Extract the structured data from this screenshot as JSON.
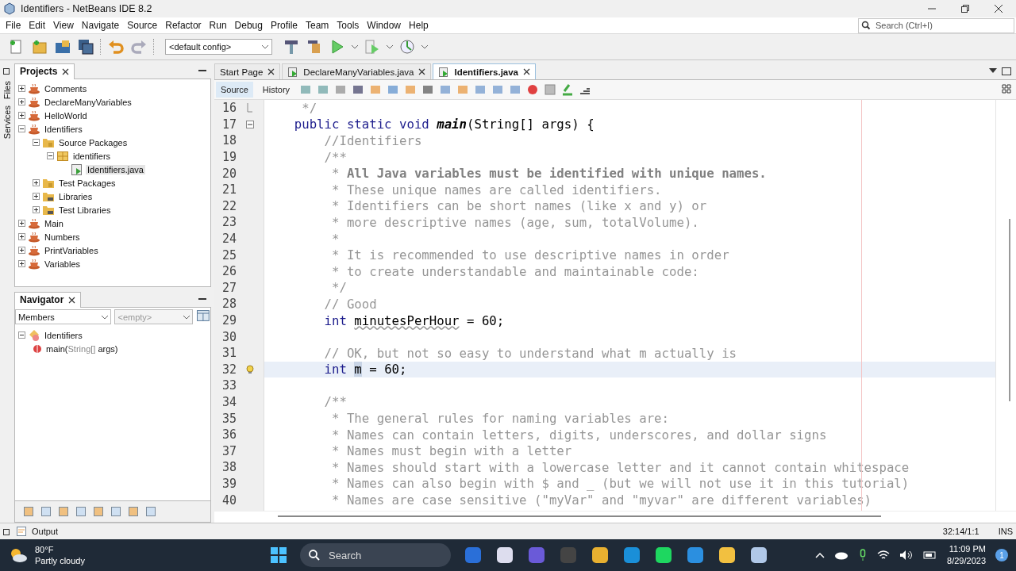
{
  "window": {
    "title": "Identifiers - NetBeans IDE 8.2"
  },
  "menu": [
    "File",
    "Edit",
    "View",
    "Navigate",
    "Source",
    "Refactor",
    "Run",
    "Debug",
    "Profile",
    "Team",
    "Tools",
    "Window",
    "Help"
  ],
  "search": {
    "placeholder": "Search (Ctrl+I)"
  },
  "toolbar": {
    "config": "<default config>"
  },
  "side_tabs": [
    "Files",
    "Services"
  ],
  "projects": {
    "title": "Projects",
    "items": [
      {
        "label": "Comments",
        "kind": "project",
        "expanded": false,
        "selected": false
      },
      {
        "label": "DeclareManyVariables",
        "kind": "project",
        "expanded": false,
        "selected": false
      },
      {
        "label": "HelloWorld",
        "kind": "project",
        "expanded": false,
        "selected": false
      },
      {
        "label": "Identifiers",
        "kind": "project",
        "expanded": true,
        "selected": false,
        "children": [
          {
            "label": "Source Packages",
            "kind": "folder",
            "expanded": true,
            "selected": false,
            "children": [
              {
                "label": "identifiers",
                "kind": "package",
                "expanded": true,
                "selected": false,
                "children": [
                  {
                    "label": "Identifiers.java",
                    "kind": "file",
                    "selected": true
                  }
                ]
              }
            ]
          },
          {
            "label": "Test Packages",
            "kind": "folder",
            "expanded": false,
            "selected": false
          },
          {
            "label": "Libraries",
            "kind": "library",
            "expanded": false,
            "selected": false
          },
          {
            "label": "Test Libraries",
            "kind": "library",
            "expanded": false,
            "selected": false
          }
        ]
      },
      {
        "label": "Main",
        "kind": "project",
        "expanded": false,
        "selected": false
      },
      {
        "label": "Numbers",
        "kind": "project",
        "expanded": false,
        "selected": false
      },
      {
        "label": "PrintVariables",
        "kind": "project",
        "expanded": false,
        "selected": false
      },
      {
        "label": "Variables",
        "kind": "project",
        "expanded": false,
        "selected": false
      }
    ]
  },
  "navigator": {
    "title": "Navigator",
    "filter": "Members",
    "secondary": {
      "placeholder": "<empty>",
      "disabled": true
    },
    "class_name": "Identifiers",
    "member": {
      "name": "main(",
      "param_type": "String[]",
      "param_rest": " args)"
    }
  },
  "editor_tabs": [
    {
      "label": "Start Page",
      "selected": false
    },
    {
      "label": "DeclareManyVariables.java",
      "selected": false
    },
    {
      "label": "Identifiers.java",
      "selected": true
    }
  ],
  "view_tabs": [
    {
      "label": "Source",
      "selected": true
    },
    {
      "label": "History",
      "selected": false
    }
  ],
  "code": [
    {
      "number": "16",
      "current": false,
      "hint": false,
      "fold_end": true,
      "fold_start": false,
      "tokens": [
        {
          "kind": "doc",
          "text": "     */"
        }
      ]
    },
    {
      "number": "17",
      "current": false,
      "hint": false,
      "fold_end": false,
      "fold_start": true,
      "tokens": [
        {
          "kind": "keyword",
          "text": "    public static void "
        },
        {
          "kind": "method",
          "text": "main"
        },
        {
          "kind": "plain",
          "text": "(String[] args) {"
        }
      ]
    },
    {
      "number": "18",
      "current": false,
      "hint": false,
      "tokens": [
        {
          "kind": "comment",
          "text": "        //Identifiers"
        }
      ]
    },
    {
      "number": "19",
      "current": false,
      "hint": false,
      "tokens": [
        {
          "kind": "doc",
          "text": "        /**"
        }
      ]
    },
    {
      "number": "20",
      "current": false,
      "hint": false,
      "tokens": [
        {
          "kind": "doc",
          "text": "         * "
        },
        {
          "kind": "doc-bold",
          "text": "All Java variables must be identified with unique names."
        }
      ]
    },
    {
      "number": "21",
      "current": false,
      "hint": false,
      "tokens": [
        {
          "kind": "doc",
          "text": "         * These unique names are called identifiers."
        }
      ]
    },
    {
      "number": "22",
      "current": false,
      "hint": false,
      "tokens": [
        {
          "kind": "doc",
          "text": "         * Identifiers can be short names (like x and y) or"
        }
      ]
    },
    {
      "number": "23",
      "current": false,
      "hint": false,
      "tokens": [
        {
          "kind": "doc",
          "text": "         * more descriptive names (age, sum, totalVolume)."
        }
      ]
    },
    {
      "number": "24",
      "current": false,
      "hint": false,
      "tokens": [
        {
          "kind": "doc",
          "text": "         *"
        }
      ]
    },
    {
      "number": "25",
      "current": false,
      "hint": false,
      "tokens": [
        {
          "kind": "doc",
          "text": "         * It is recommended to use descriptive names in order"
        }
      ]
    },
    {
      "number": "26",
      "current": false,
      "hint": false,
      "tokens": [
        {
          "kind": "doc",
          "text": "         * to create understandable and maintainable code:"
        }
      ]
    },
    {
      "number": "27",
      "current": false,
      "hint": false,
      "tokens": [
        {
          "kind": "doc",
          "text": "         */"
        }
      ]
    },
    {
      "number": "28",
      "current": false,
      "hint": false,
      "tokens": [
        {
          "kind": "comment",
          "text": "        // Good"
        }
      ]
    },
    {
      "number": "29",
      "current": false,
      "hint": false,
      "tokens": [
        {
          "kind": "keyword",
          "text": "        int "
        },
        {
          "kind": "warned",
          "text": "minutesPerHour"
        },
        {
          "kind": "plain",
          "text": " = 60;"
        }
      ]
    },
    {
      "number": "30",
      "current": false,
      "hint": false
    },
    {
      "number": "31",
      "current": false,
      "hint": false,
      "tokens": [
        {
          "kind": "comment",
          "text": "        // OK, but not so easy to understand what m actually is"
        }
      ]
    },
    {
      "number": "32",
      "current": true,
      "hint": true,
      "tokens": [
        {
          "kind": "keyword",
          "text": "        int "
        },
        {
          "kind": "selected",
          "text": "m"
        },
        {
          "kind": "plain",
          "text": " = 60;"
        }
      ]
    },
    {
      "number": "33",
      "current": false,
      "hint": false
    },
    {
      "number": "34",
      "current": false,
      "hint": false,
      "tokens": [
        {
          "kind": "doc",
          "text": "        /**"
        }
      ]
    },
    {
      "number": "35",
      "current": false,
      "hint": false,
      "tokens": [
        {
          "kind": "doc",
          "text": "         * The general rules for naming variables are:"
        }
      ]
    },
    {
      "number": "36",
      "current": false,
      "hint": false,
      "tokens": [
        {
          "kind": "doc",
          "text": "         * Names can contain letters, digits, underscores, and dollar signs"
        }
      ]
    },
    {
      "number": "37",
      "current": false,
      "hint": false,
      "tokens": [
        {
          "kind": "doc",
          "text": "         * Names must begin with a letter"
        }
      ]
    },
    {
      "number": "38",
      "current": false,
      "hint": false,
      "tokens": [
        {
          "kind": "doc",
          "text": "         * Names should start with a lowercase letter and it cannot contain whitespace"
        }
      ]
    },
    {
      "number": "39",
      "current": false,
      "hint": false,
      "tokens": [
        {
          "kind": "doc",
          "text": "         * Names can also begin with $ and _ (but we will not use it in this tutorial)"
        }
      ]
    },
    {
      "number": "40",
      "current": false,
      "hint": false,
      "tokens": [
        {
          "kind": "doc",
          "text": "         * Names are case sensitive (\"myVar\" and \"myvar\" are different variables)"
        }
      ]
    }
  ],
  "status_bar": {
    "output": "Output",
    "position": "32:14/1:1",
    "mode": "INS"
  },
  "taskbar": {
    "temperature": "80°F",
    "weather": "Partly cloudy",
    "search": "Search",
    "time": "11:09 PM",
    "date": "8/29/2023",
    "badge": "1"
  }
}
